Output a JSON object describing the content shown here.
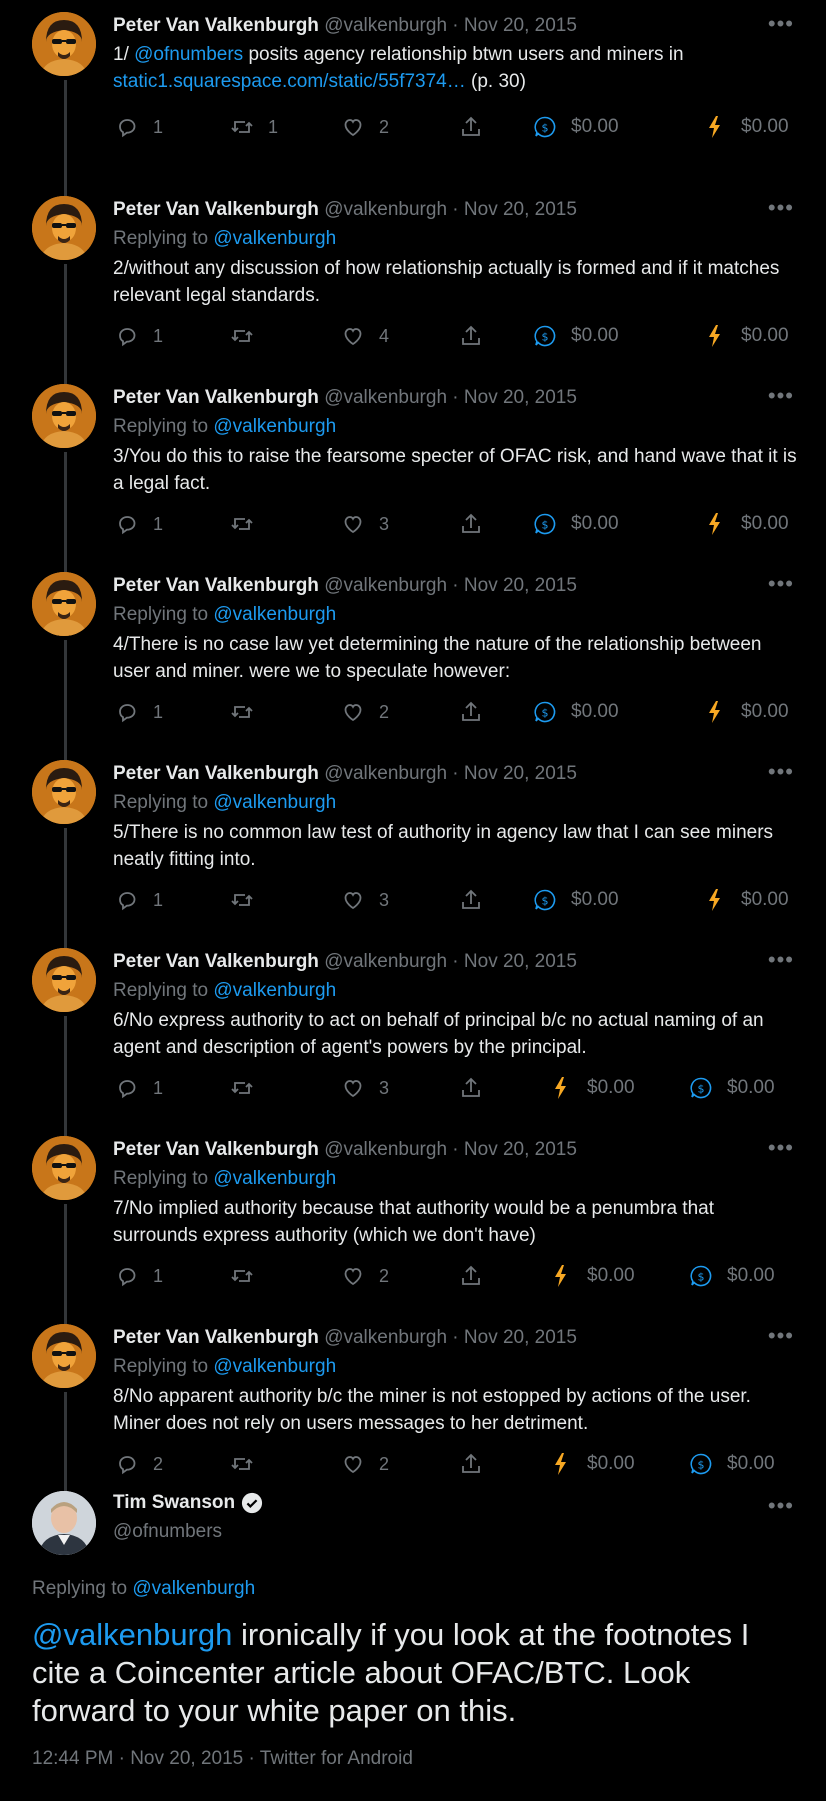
{
  "colors": {
    "background": "#000000",
    "text": "#e7e9ea",
    "muted": "#71767b",
    "link": "#1d9bf0",
    "lightning": "#f7a823"
  },
  "tweets": [
    {
      "name": "Peter Van Valkenburgh",
      "handle": "@valkenburgh",
      "date": "Nov 20, 2015",
      "replying_label": "",
      "replying_to": "",
      "text_parts": [
        "1/ ",
        "@ofnumbers",
        " posits agency relationship btwn users and miners in ",
        "static1.squarespace.com/static/55f7374…",
        " (p. 30)"
      ],
      "replies": "1",
      "retweets": "1",
      "likes": "2",
      "tip_dollar": "$0.00",
      "tip_lightning": "$0.00",
      "tip_order": "dollar-first"
    },
    {
      "name": "Peter Van Valkenburgh",
      "handle": "@valkenburgh",
      "date": "Nov 20, 2015",
      "replying_label": "Replying to",
      "replying_to": "@valkenburgh",
      "text": "2/without any discussion of how relationship actually is formed and if it matches relevant legal standards.",
      "replies": "1",
      "retweets": "",
      "likes": "4",
      "tip_dollar": "$0.00",
      "tip_lightning": "$0.00",
      "tip_order": "dollar-first"
    },
    {
      "name": "Peter Van Valkenburgh",
      "handle": "@valkenburgh",
      "date": "Nov 20, 2015",
      "replying_label": "Replying to",
      "replying_to": "@valkenburgh",
      "text": "3/You do this to raise the fearsome specter of OFAC risk, and hand wave that it is a legal fact.",
      "replies": "1",
      "retweets": "",
      "likes": "3",
      "tip_dollar": "$0.00",
      "tip_lightning": "$0.00",
      "tip_order": "dollar-first"
    },
    {
      "name": "Peter Van Valkenburgh",
      "handle": "@valkenburgh",
      "date": "Nov 20, 2015",
      "replying_label": "Replying to",
      "replying_to": "@valkenburgh",
      "text": "4/There is no case law yet determining the nature of the relationship between user and miner. were we to speculate however:",
      "replies": "1",
      "retweets": "",
      "likes": "2",
      "tip_dollar": "$0.00",
      "tip_lightning": "$0.00",
      "tip_order": "dollar-first"
    },
    {
      "name": "Peter Van Valkenburgh",
      "handle": "@valkenburgh",
      "date": "Nov 20, 2015",
      "replying_label": "Replying to",
      "replying_to": "@valkenburgh",
      "text": "5/There is no common law test of authority in agency law that I can see miners neatly fitting into.",
      "replies": "1",
      "retweets": "",
      "likes": "3",
      "tip_dollar": "$0.00",
      "tip_lightning": "$0.00",
      "tip_order": "dollar-first"
    },
    {
      "name": "Peter Van Valkenburgh",
      "handle": "@valkenburgh",
      "date": "Nov 20, 2015",
      "replying_label": "Replying to",
      "replying_to": "@valkenburgh",
      "text": "6/No express authority to act on behalf of principal b/c no actual naming of an agent and description of agent's powers by the principal.",
      "replies": "1",
      "retweets": "",
      "likes": "3",
      "tip_dollar": "$0.00",
      "tip_lightning": "$0.00",
      "tip_order": "lightning-first"
    },
    {
      "name": "Peter Van Valkenburgh",
      "handle": "@valkenburgh",
      "date": "Nov 20, 2015",
      "replying_label": "Replying to",
      "replying_to": "@valkenburgh",
      "text": "7/No implied authority because that authority would be a penumbra that surrounds express authority (which we don't have)",
      "replies": "1",
      "retweets": "",
      "likes": "2",
      "tip_dollar": "$0.00",
      "tip_lightning": "$0.00",
      "tip_order": "lightning-first"
    },
    {
      "name": "Peter Van Valkenburgh",
      "handle": "@valkenburgh",
      "date": "Nov 20, 2015",
      "replying_label": "Replying to",
      "replying_to": "@valkenburgh",
      "text": "8/No apparent authority b/c the miner is not estopped by actions of the user. Miner does not rely on users messages to her detriment.",
      "replies": "2",
      "retweets": "",
      "likes": "2",
      "tip_dollar": "$0.00",
      "tip_lightning": "$0.00",
      "tip_order": "lightning-first"
    }
  ],
  "main_tweet": {
    "name": "Tim Swanson",
    "handle": "@ofnumbers",
    "replying_label": "Replying to",
    "replying_to": "@valkenburgh",
    "mention": "@valkenburgh",
    "text": " ironically if you look at the footnotes I cite a Coincenter article about OFAC/BTC.  Look forward to your white paper on this.",
    "timestamp": "12:44 PM · Nov 20, 2015 · Twitter for Android"
  },
  "icons": {
    "reply": "reply-icon",
    "retweet": "retweet-icon",
    "like": "heart-icon",
    "share": "share-icon",
    "tip_dollar": "dollar-tip-icon",
    "tip_lightning": "lightning-tip-icon",
    "more": "more-icon",
    "verified": "verified-badge-icon"
  }
}
